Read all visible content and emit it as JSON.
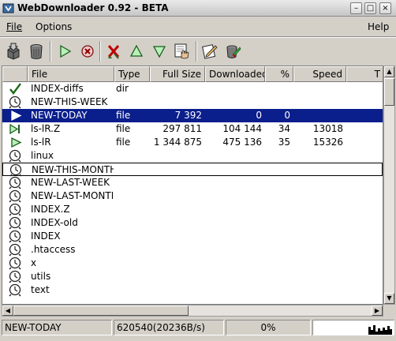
{
  "window": {
    "title": "WebDownloader 0.92 - BETA"
  },
  "menu": {
    "file": "File",
    "options": "Options",
    "help": "Help"
  },
  "toolbar": {
    "buttons": [
      {
        "name": "download-icon"
      },
      {
        "name": "trash-icon"
      },
      {
        "name": "play-icon"
      },
      {
        "name": "stop-icon"
      },
      {
        "name": "delete-icon"
      },
      {
        "name": "move-up-icon"
      },
      {
        "name": "move-down-icon"
      },
      {
        "name": "grab-icon"
      },
      {
        "name": "edit-icon"
      },
      {
        "name": "clear-icon"
      }
    ]
  },
  "columns": {
    "file": "File",
    "type": "Type",
    "full_size": "Full Size",
    "downloaded": "Downloaded",
    "percent": "%",
    "speed": "Speed",
    "time": "T"
  },
  "rows": [
    {
      "status": "check",
      "file": "INDEX-diffs",
      "type": "dir",
      "size": "",
      "downloaded": "",
      "percent": "",
      "speed": ""
    },
    {
      "status": "clock",
      "file": "NEW-THIS-WEEK",
      "type": "",
      "size": "",
      "downloaded": "",
      "percent": "",
      "speed": ""
    },
    {
      "status": "play",
      "file": "NEW-TODAY",
      "type": "file",
      "size": "7 392",
      "downloaded": "0",
      "percent": "0",
      "speed": ""
    },
    {
      "status": "playbar",
      "file": "ls-lR.Z",
      "type": "file",
      "size": "297 811",
      "downloaded": "104 144",
      "percent": "34",
      "speed": "13018"
    },
    {
      "status": "play",
      "file": "ls-lR",
      "type": "file",
      "size": "1 344 875",
      "downloaded": "475 136",
      "percent": "35",
      "speed": "15326"
    },
    {
      "status": "clock",
      "file": "linux",
      "type": "",
      "size": "",
      "downloaded": "",
      "percent": "",
      "speed": ""
    },
    {
      "status": "clock",
      "file": "NEW-THIS-MONTH",
      "type": "",
      "size": "",
      "downloaded": "",
      "percent": "",
      "speed": ""
    },
    {
      "status": "clock",
      "file": "NEW-LAST-WEEK",
      "type": "",
      "size": "",
      "downloaded": "",
      "percent": "",
      "speed": ""
    },
    {
      "status": "clock",
      "file": "NEW-LAST-MONTH",
      "type": "",
      "size": "",
      "downloaded": "",
      "percent": "",
      "speed": ""
    },
    {
      "status": "clock",
      "file": "INDEX.Z",
      "type": "",
      "size": "",
      "downloaded": "",
      "percent": "",
      "speed": ""
    },
    {
      "status": "clock",
      "file": "INDEX-old",
      "type": "",
      "size": "",
      "downloaded": "",
      "percent": "",
      "speed": ""
    },
    {
      "status": "clock",
      "file": "INDEX",
      "type": "",
      "size": "",
      "downloaded": "",
      "percent": "",
      "speed": ""
    },
    {
      "status": "clock",
      "file": ".htaccess",
      "type": "",
      "size": "",
      "downloaded": "",
      "percent": "",
      "speed": ""
    },
    {
      "status": "clock",
      "file": "x",
      "type": "",
      "size": "",
      "downloaded": "",
      "percent": "",
      "speed": ""
    },
    {
      "status": "clock",
      "file": "utils",
      "type": "",
      "size": "",
      "downloaded": "",
      "percent": "",
      "speed": ""
    },
    {
      "status": "clock",
      "file": "text",
      "type": "",
      "size": "",
      "downloaded": "",
      "percent": "",
      "speed": ""
    }
  ],
  "selected_row": 2,
  "focused_row": 6,
  "status": {
    "current_file": "NEW-TODAY",
    "bytes_rate": "620540(20236B/s)",
    "percent": "0%"
  },
  "colors": {
    "selection": "#0a1e8c",
    "chrome": "#d4d0c8"
  }
}
